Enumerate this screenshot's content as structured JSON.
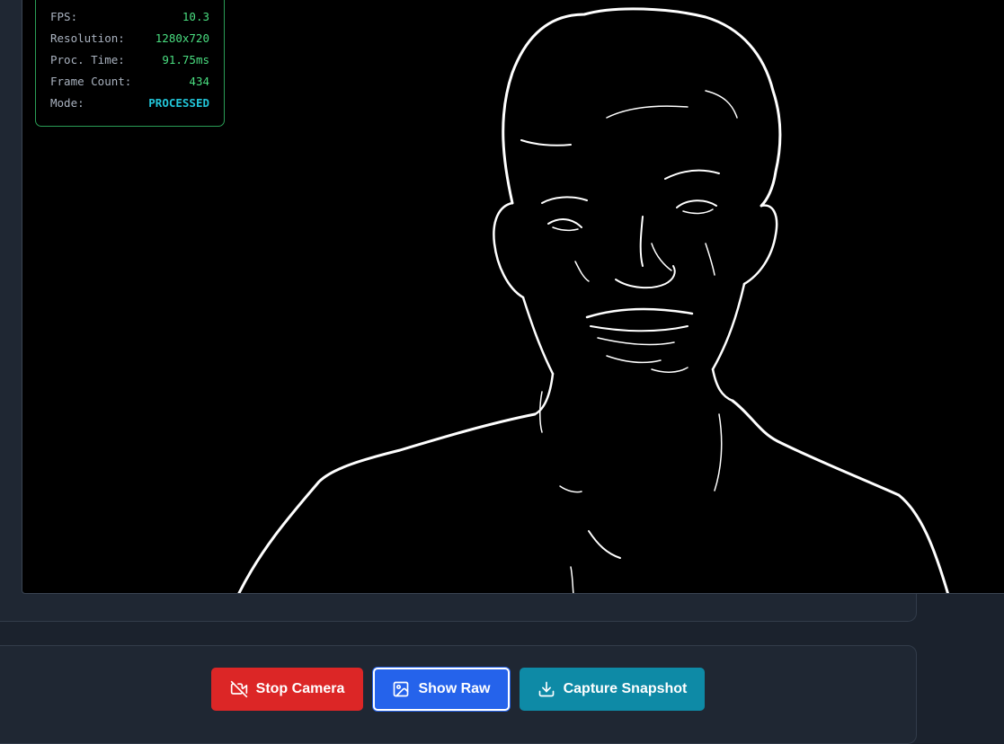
{
  "stats": {
    "rows": [
      {
        "label": "FPS:",
        "value": "10.3"
      },
      {
        "label": "Resolution:",
        "value": "1280x720"
      },
      {
        "label": "Proc. Time:",
        "value": "91.75ms"
      },
      {
        "label": "Frame Count:",
        "value": "434"
      },
      {
        "label": "Mode:",
        "value": "PROCESSED"
      }
    ]
  },
  "video": {
    "description_icon": "edge-detected-frame"
  },
  "controls": {
    "stop_label": "Stop Camera",
    "stop_icon": "video-off-icon",
    "raw_label": "Show Raw",
    "raw_icon": "image-icon",
    "capture_label": "Capture Snapshot",
    "capture_icon": "download-icon"
  },
  "colors": {
    "stop": "#dc2626",
    "raw": "#2563eb",
    "capture": "#0e8aa6",
    "stat_value": "#4ade80",
    "mode_value": "#22c5d8"
  }
}
